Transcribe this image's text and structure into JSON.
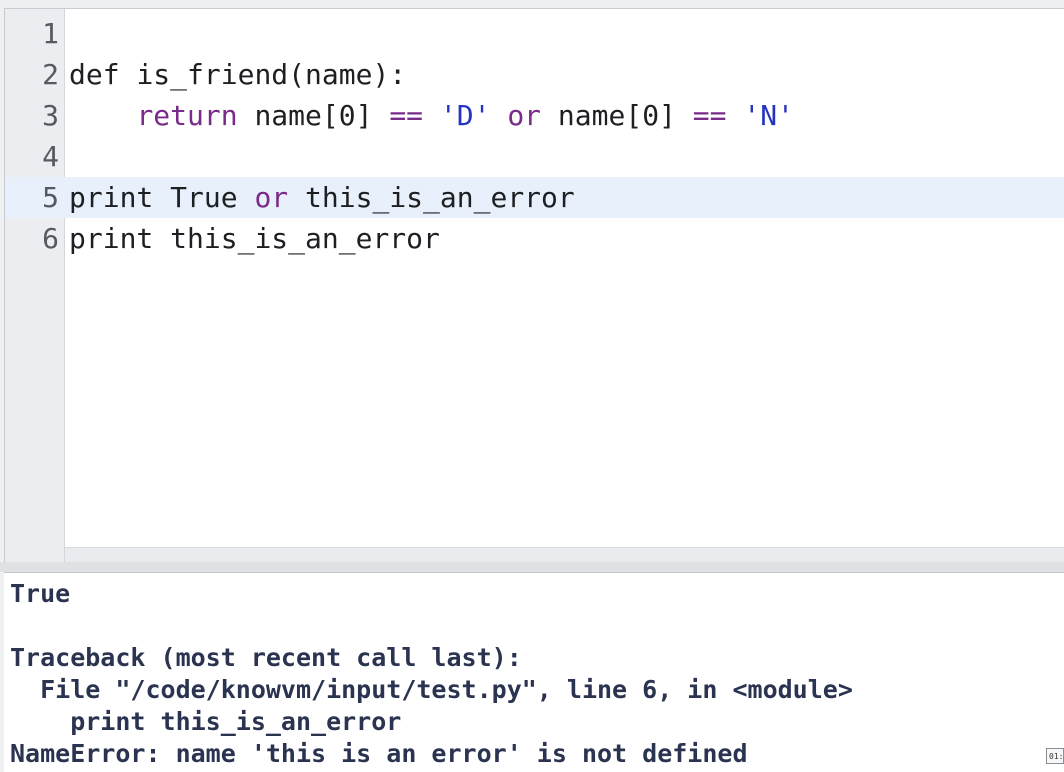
{
  "editor": {
    "lines": [
      {
        "number": "1",
        "tokens": []
      },
      {
        "number": "2",
        "tokens": [
          {
            "text": "def ",
            "style": "plain"
          },
          {
            "text": "is_friend(name):",
            "style": "plain"
          }
        ]
      },
      {
        "number": "3",
        "tokens": [
          {
            "text": "    ",
            "style": "plain"
          },
          {
            "text": "return",
            "style": "kw-purple"
          },
          {
            "text": " name[0] ",
            "style": "plain"
          },
          {
            "text": "==",
            "style": "kw-purple"
          },
          {
            "text": " ",
            "style": "plain"
          },
          {
            "text": "'D'",
            "style": "str-blue"
          },
          {
            "text": " ",
            "style": "plain"
          },
          {
            "text": "or",
            "style": "kw-purple"
          },
          {
            "text": " name[0] ",
            "style": "plain"
          },
          {
            "text": "==",
            "style": "kw-purple"
          },
          {
            "text": " ",
            "style": "plain"
          },
          {
            "text": "'N'",
            "style": "str-blue"
          }
        ]
      },
      {
        "number": "4",
        "tokens": []
      },
      {
        "number": "5",
        "active": true,
        "tokens": [
          {
            "text": "print",
            "style": "plain"
          },
          {
            "text": " True ",
            "style": "plain"
          },
          {
            "text": "or",
            "style": "kw-purple"
          },
          {
            "text": " this_is_an_error",
            "style": "plain"
          }
        ]
      },
      {
        "number": "6",
        "tokens": [
          {
            "text": "print",
            "style": "plain"
          },
          {
            "text": " this_is_an_error",
            "style": "plain"
          }
        ]
      }
    ]
  },
  "output": {
    "lines": [
      "True",
      "",
      "Traceback (most recent call last):",
      "  File \"/code/knowvm/input/test.py\", line 6, in <module>",
      "    print this_is_an_error",
      "NameError: name 'this is an error' is not defined"
    ]
  },
  "timestamp": "01:",
  "colors": {
    "keyword": "#7a2a88",
    "string": "#2433c2",
    "active_line": "#e8f1fb",
    "output_text": "#2a3350"
  }
}
